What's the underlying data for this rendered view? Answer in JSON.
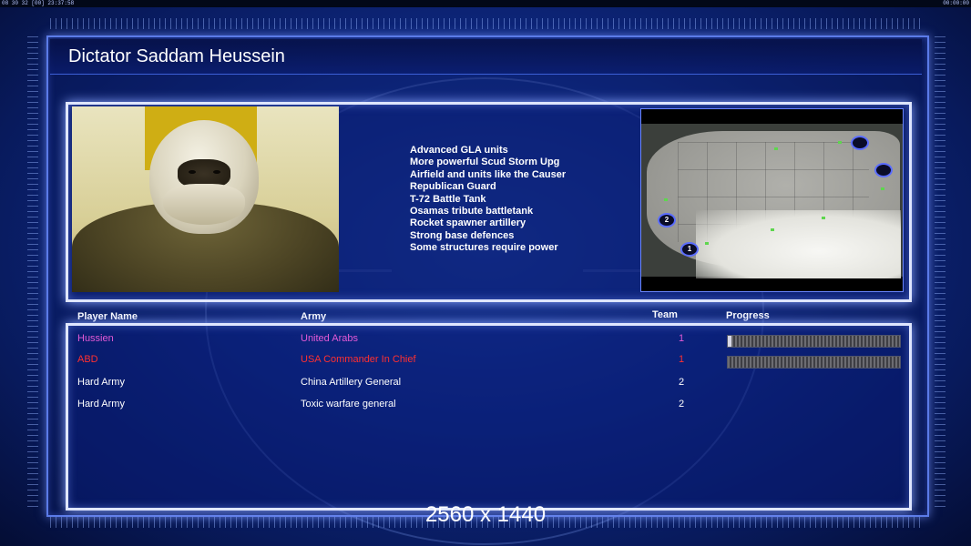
{
  "status_bar": {
    "left_text": "08 30 32 [00] 23:37:58",
    "right_text": "00:00:00"
  },
  "window": {
    "title": "Dictator Saddam Heussein"
  },
  "briefing": {
    "features": [
      "Advanced GLA units",
      "More powerful Scud Storm Upg",
      "Airfield and units like the Causer",
      "Republican Guard",
      "T-72 Battle Tank",
      "Osamas tribute battletank",
      "Rocket spawner artillery",
      "Strong base defences",
      "Some structures require power"
    ]
  },
  "map": {
    "spawn_points": [
      "",
      "",
      "2",
      "1"
    ]
  },
  "players_table": {
    "columns": [
      "Player Name",
      "Army",
      "Team",
      "Progress"
    ],
    "rows": [
      {
        "name": "Hussien",
        "army": "United Arabs",
        "team": "1",
        "color": "#e35ad6",
        "progress": 0.02
      },
      {
        "name": "ABD",
        "army": "USA Commander In Chief",
        "team": "1",
        "color": "#ff3030",
        "progress": 0.0
      },
      {
        "name": "Hard Army",
        "army": "China Artillery General",
        "team": "2",
        "color": "#ffffff",
        "progress": null
      },
      {
        "name": "Hard Army",
        "army": "Toxic warfare general",
        "team": "2",
        "color": "#ffffff",
        "progress": null
      }
    ]
  },
  "overlay": {
    "resolution_label": "2560 x 1440"
  },
  "colors": {
    "accent": "#5b7be8",
    "panel_border": "#dfe6ff",
    "background": "#0f2a86"
  }
}
